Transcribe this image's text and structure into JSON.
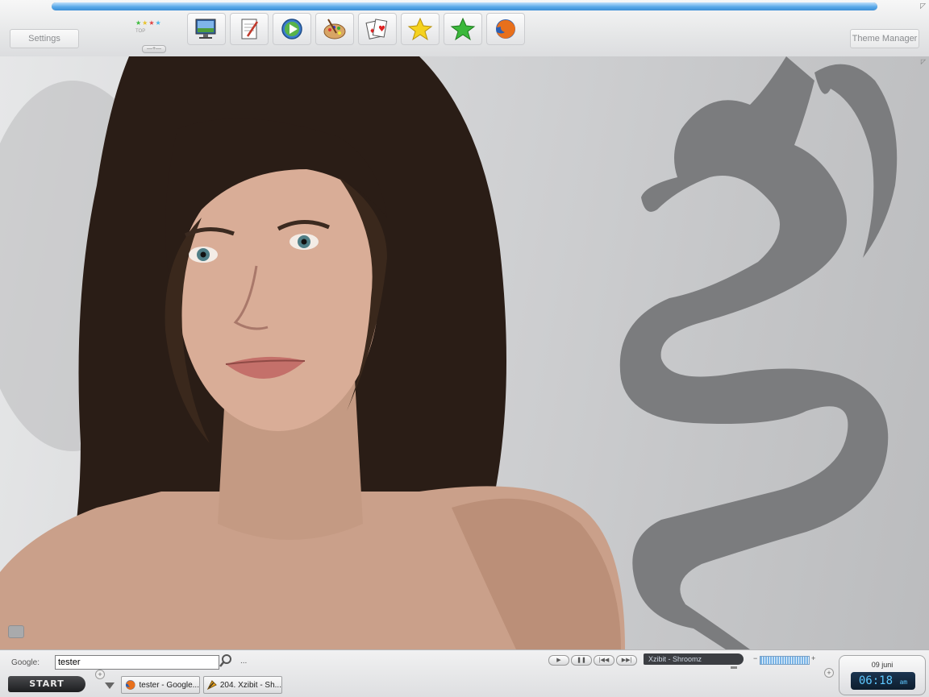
{
  "top_bar": {
    "progress_percent": 100,
    "settings_label": "Settings",
    "theme_manager_label": "Theme Manager",
    "top_label": "TOP",
    "dock_icons": [
      {
        "name": "desktop-icon"
      },
      {
        "name": "notepad-icon"
      },
      {
        "name": "media-play-icon"
      },
      {
        "name": "paint-palette-icon"
      },
      {
        "name": "cards-icon"
      },
      {
        "name": "yellow-star-icon"
      },
      {
        "name": "green-star-icon"
      },
      {
        "name": "firefox-icon"
      }
    ]
  },
  "bottom_bar": {
    "google_label": "Google:",
    "google_value": "tester",
    "google_more": "...",
    "start_label": "START",
    "tasks": [
      {
        "label": "tester - Google...",
        "icon": "firefox-icon"
      },
      {
        "label": "204. Xzibit - Sh...",
        "icon": "winamp-icon"
      }
    ],
    "media": {
      "buttons": [
        "▶",
        "❚❚",
        "|◀◀",
        "▶▶|"
      ],
      "track": "Xzibit - Shroomz",
      "volume_minus": "−",
      "volume_plus": "+"
    },
    "clock": {
      "date": "09 juni",
      "time": "06:18",
      "ampm": "am"
    }
  },
  "colors": {
    "accent_blue": "#3d8fd6",
    "clock_text": "#5ec8ff",
    "dragon_gray": "#7b7c7e"
  }
}
